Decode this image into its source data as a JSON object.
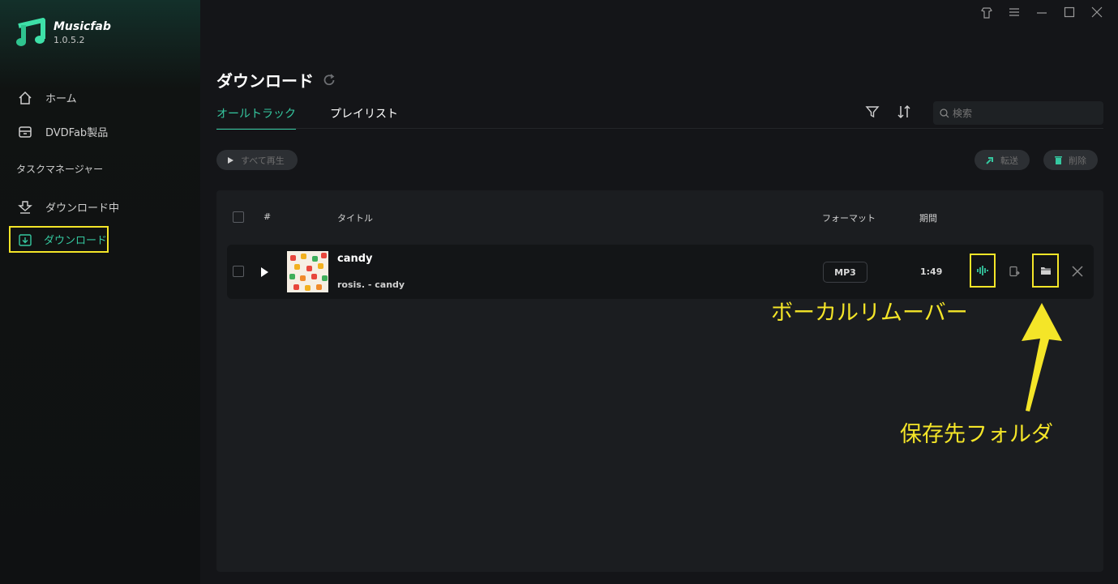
{
  "app": {
    "name": "Musicfab",
    "version": "1.0.5.2"
  },
  "sidebar": {
    "items": [
      {
        "label": "ホーム",
        "icon": "home-icon"
      },
      {
        "label": "DVDFab製品",
        "icon": "box-icon"
      }
    ],
    "section_label": "タスクマネージャー",
    "task_items": [
      {
        "label": "ダウンロード中",
        "icon": "downloading-icon"
      },
      {
        "label": "ダウンロード",
        "icon": "downloaded-icon",
        "active": true
      }
    ]
  },
  "window_controls": [
    "shirt-icon",
    "menu-icon",
    "minimize-icon",
    "maximize-icon",
    "close-icon"
  ],
  "page": {
    "title": "ダウンロード",
    "tabs": [
      {
        "label": "オールトラック",
        "active": true
      },
      {
        "label": "プレイリスト",
        "active": false
      }
    ],
    "search_placeholder": "検索",
    "play_all_label": "すべて再生",
    "transfer_label": "転送",
    "delete_label": "削除"
  },
  "table": {
    "headers": {
      "index": "#",
      "title": "タイトル",
      "format": "フォーマット",
      "duration": "期間"
    },
    "rows": [
      {
        "title": "candy",
        "artist": "rosis. - candy",
        "format": "MP3",
        "duration": "1:49"
      }
    ]
  },
  "annotations": {
    "vocal_remover": "ボーカルリムーバー",
    "save_folder": "保存先フォルダ"
  },
  "colors": {
    "accent": "#35c8a0",
    "highlight": "#f4e528",
    "background": "#141518"
  }
}
